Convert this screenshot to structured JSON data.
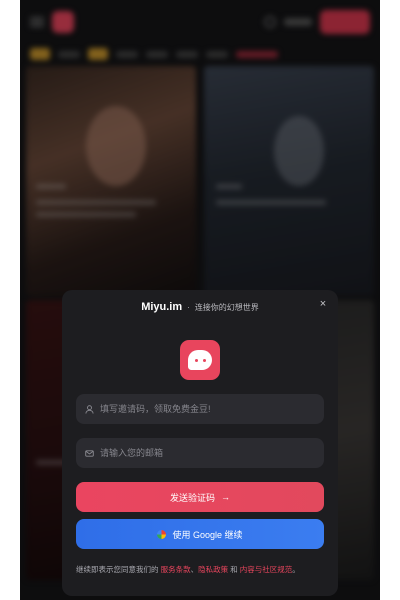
{
  "modal": {
    "brand": "Miyu.im",
    "subtitle": "连接你的幻想世界",
    "close_icon": "×",
    "invite_placeholder": "填写邀请码，领取免费金豆!",
    "email_placeholder": "请输入您的邮箱",
    "send_label": "发送验证码",
    "send_arrow": "→",
    "google_label": "使用 Google 继续",
    "terms_prefix": "继续即表示您同意我们的",
    "terms_service": "服务条款",
    "terms_sep": "、",
    "terms_privacy": "隐私政策",
    "terms_and": "和",
    "terms_community": "内容与社区规范",
    "terms_end": "。"
  },
  "colors": {
    "accent": "#e8455d",
    "google_blue": "#2f6ee8",
    "modal_bg": "#1d1d20"
  },
  "icons": {
    "invite": "user-icon",
    "email": "mail-icon",
    "app": "chat-bubble-icon",
    "google": "google-icon"
  }
}
